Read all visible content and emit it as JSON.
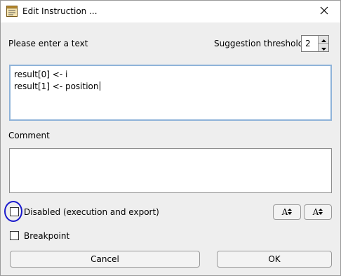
{
  "window": {
    "title": "Edit Instruction ...",
    "icon": "window-app-icon",
    "close_icon": "close-icon"
  },
  "form": {
    "prompt_label": "Please enter a text",
    "suggestion_label": "Suggestion threshold",
    "suggestion_value": "2",
    "text_lines": [
      "result[0] <- i",
      "result[1] <- position"
    ],
    "comment_label": "Comment",
    "comment_value": "",
    "disabled_label": "Disabled (execution and export)",
    "disabled_checked": false,
    "breakpoint_label": "Breakpoint",
    "breakpoint_checked": false,
    "font_increase_label": "A",
    "font_decrease_label": "A"
  },
  "buttons": {
    "cancel": "Cancel",
    "ok": "OK"
  }
}
